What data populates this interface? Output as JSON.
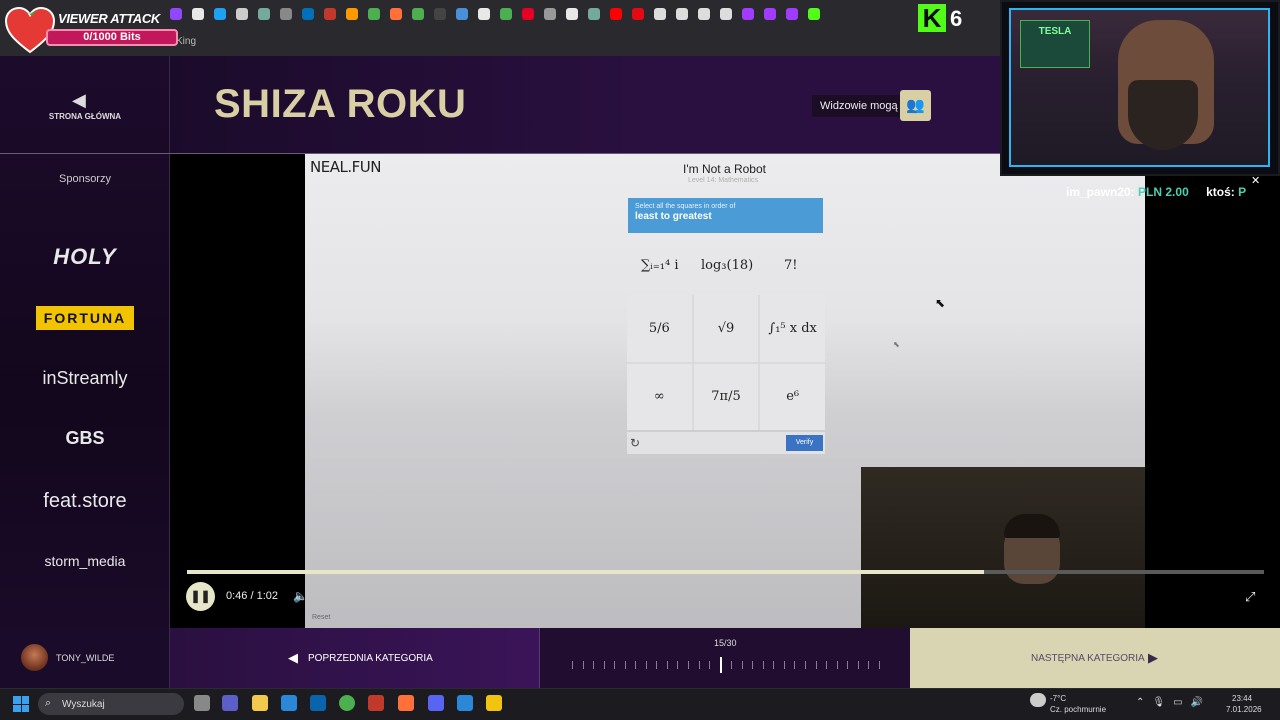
{
  "browser": {
    "bookmark_fragment": "King",
    "favicons": [
      "twitch-favicon",
      "chrome-favicon",
      "twitter-favicon",
      "github-favicon",
      "openai-favicon",
      "gear-favicon",
      "paypal-favicon",
      "reader-favicon",
      "amazon-favicon",
      "chrome-favicon",
      "firefox-favicon",
      "chrome-favicon",
      "codepen-favicon",
      "link-favicon",
      "chrome-favicon",
      "chrome-favicon",
      "pinterest-favicon",
      "settings-favicon",
      "chrome-favicon",
      "openai-favicon",
      "youtube-favicon",
      "netflix-favicon",
      "grid-favicon",
      "grid-favicon",
      "grid-favicon",
      "grid-favicon",
      "opera-favicon",
      "opera-favicon",
      "opera-favicon",
      "kick-favicon"
    ]
  },
  "viewer_attack": {
    "title": "VIEWER ATTACK",
    "bits": "0/1000 Bits"
  },
  "kick": {
    "logo_letter": "K",
    "count": "6"
  },
  "sidebar": {
    "home_label": "STRONA GŁÓWNA",
    "sponsors_title": "Sponsorzy",
    "sponsors": [
      "HOLY",
      "FORTUNA",
      "inStreamly",
      "GBS",
      "feat.store",
      "storm_media"
    ]
  },
  "header": {
    "title": "SHIZA ROKU",
    "viewers_label": "Widzowie mogą"
  },
  "video_page": {
    "logo": "NEAL.FUN",
    "title": "I'm Not a Robot",
    "subtitle": "Level 14: Mathematics",
    "captcha_small": "Select all the squares in order of",
    "captcha_big": "least to greatest",
    "top_expressions": [
      "∑ᵢ₌₁⁴ i",
      "log₃(18)",
      "7!"
    ],
    "grid_cells": [
      "5/6",
      "√9",
      "∫₁⁵ x dx",
      "∞",
      "7π/5",
      "e⁶"
    ],
    "verify_label": "Verify",
    "reset_label": "Reset"
  },
  "stream": {
    "cam_sign": "TESLA",
    "donation_user": "im_pawn20:",
    "donation_amount": "PLN 2.00",
    "donation_user2": "ktoś:",
    "donation_amount2": "P"
  },
  "player": {
    "time": "0:46 / 1:02",
    "progress": 0.74
  },
  "bottom": {
    "username": "TONY_WILDE",
    "prev_label": "POPRZEDNIA KATEGORIA",
    "counter": "15/30",
    "current_index": 15,
    "total": 30,
    "next_label": "NASTĘPNA KATEGORIA"
  },
  "taskbar": {
    "search_label": "Wyszukaj",
    "apps": [
      "task-view",
      "teams",
      "file-explorer",
      "store",
      "mail",
      "chrome",
      "wetter-app",
      "firefox",
      "discord",
      "photos",
      "norton"
    ],
    "weather_temp": "-7°C",
    "weather_desc": "Cz. pochmurnie",
    "time": "23:44",
    "date": "7.01.2026"
  },
  "colors": {
    "accent_gold": "#d9cfa5",
    "captcha_blue": "#4a9bd6",
    "verify_blue": "#3b73c4",
    "kick_green": "#53fc18"
  }
}
